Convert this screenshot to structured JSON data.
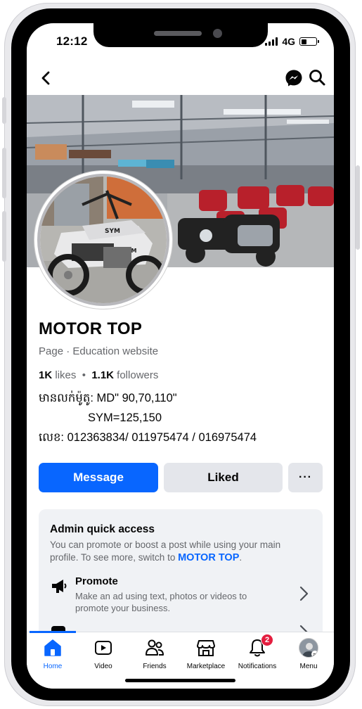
{
  "status_bar": {
    "time": "12:12",
    "network": "4G",
    "battery_level": 0.35
  },
  "header": {
    "back_icon": "chevron-left-icon",
    "messenger_icon": "messenger-icon",
    "search_icon": "search-icon"
  },
  "profile": {
    "name": "MOTOR TOP",
    "category": "Page · Education website",
    "likes_count": "1K",
    "likes_label": "likes",
    "followers_count": "1.1K",
    "followers_label": "followers",
    "bio_line1": "មានលក់ម៉ូតូ: MD\" 90,70,110\"",
    "bio_line2": "SYM=125,150",
    "bio_line3": "លេខ: 012363834/ 011975474 / 016975474"
  },
  "actions": {
    "message_label": "Message",
    "liked_label": "Liked",
    "more_label": "···"
  },
  "admin": {
    "title": "Admin quick access",
    "description": "You can promote or boost a post while using your main profile. To see more, switch to ",
    "description_link": "MOTOR TOP",
    "description_end": ".",
    "promote_title": "Promote",
    "promote_description": "Make an ad using text, photos or videos to promote your business."
  },
  "tabbar": {
    "tabs": [
      {
        "label": "Home",
        "icon": "home-icon",
        "active": true
      },
      {
        "label": "Video",
        "icon": "video-icon",
        "active": false
      },
      {
        "label": "Friends",
        "icon": "friends-icon",
        "active": false
      },
      {
        "label": "Marketplace",
        "icon": "marketplace-icon",
        "active": false
      },
      {
        "label": "Notifications",
        "icon": "bell-icon",
        "active": false,
        "badge": "2"
      },
      {
        "label": "Menu",
        "icon": "avatar",
        "active": false
      }
    ]
  },
  "colors": {
    "accent": "#0866ff",
    "button_secondary": "#e4e6eb",
    "badge": "#e41e3f"
  }
}
